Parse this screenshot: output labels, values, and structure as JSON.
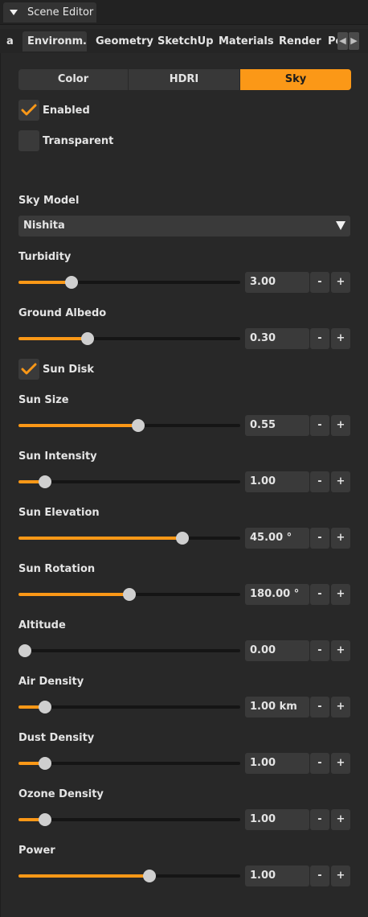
{
  "panel": {
    "title": "Scene Editor"
  },
  "tabs": [
    {
      "label": "a"
    },
    {
      "label": "Environm…"
    },
    {
      "label": "Geometry"
    },
    {
      "label": "SketchUp"
    },
    {
      "label": "Materials"
    },
    {
      "label": "Render"
    },
    {
      "label": "Po"
    }
  ],
  "active_tab": "Environm…",
  "scroll": {
    "left": "◀",
    "right": "▶"
  },
  "modes": [
    {
      "label": "Color",
      "active": false
    },
    {
      "label": "HDRI",
      "active": false
    },
    {
      "label": "Sky",
      "active": true
    }
  ],
  "checkboxes": {
    "enabled": {
      "label": "Enabled",
      "checked": true
    },
    "transparent": {
      "label": "Transparent",
      "checked": false
    },
    "sun_disk": {
      "label": "Sun Disk",
      "checked": true
    }
  },
  "sky_model": {
    "label": "Sky Model",
    "value": "Nishita"
  },
  "colors": {
    "accent": "#fb9817",
    "background": "#282828",
    "control": "#3a3a3a"
  },
  "stepper": {
    "minus": "-",
    "plus": "+"
  },
  "sliders": [
    {
      "label": "Turbidity",
      "value": "3.00",
      "fraction": 0.24
    },
    {
      "label": "Ground Albedo",
      "value": "0.30",
      "fraction": 0.31
    },
    {
      "label": "Sun Size",
      "value": "0.55",
      "fraction": 0.54
    },
    {
      "label": "Sun Intensity",
      "value": "1.00",
      "fraction": 0.12
    },
    {
      "label": "Sun Elevation",
      "value": "45.00 °",
      "fraction": 0.74
    },
    {
      "label": "Sun Rotation",
      "value": "180.00 °",
      "fraction": 0.5
    },
    {
      "label": "Altitude",
      "value": "0.00",
      "fraction": 0.03
    },
    {
      "label": "Air Density",
      "value": "1.00 km",
      "fraction": 0.12
    },
    {
      "label": "Dust Density",
      "value": "1.00",
      "fraction": 0.12
    },
    {
      "label": "Ozone Density",
      "value": "1.00",
      "fraction": 0.12
    },
    {
      "label": "Power",
      "value": "1.00",
      "fraction": 0.59
    }
  ]
}
